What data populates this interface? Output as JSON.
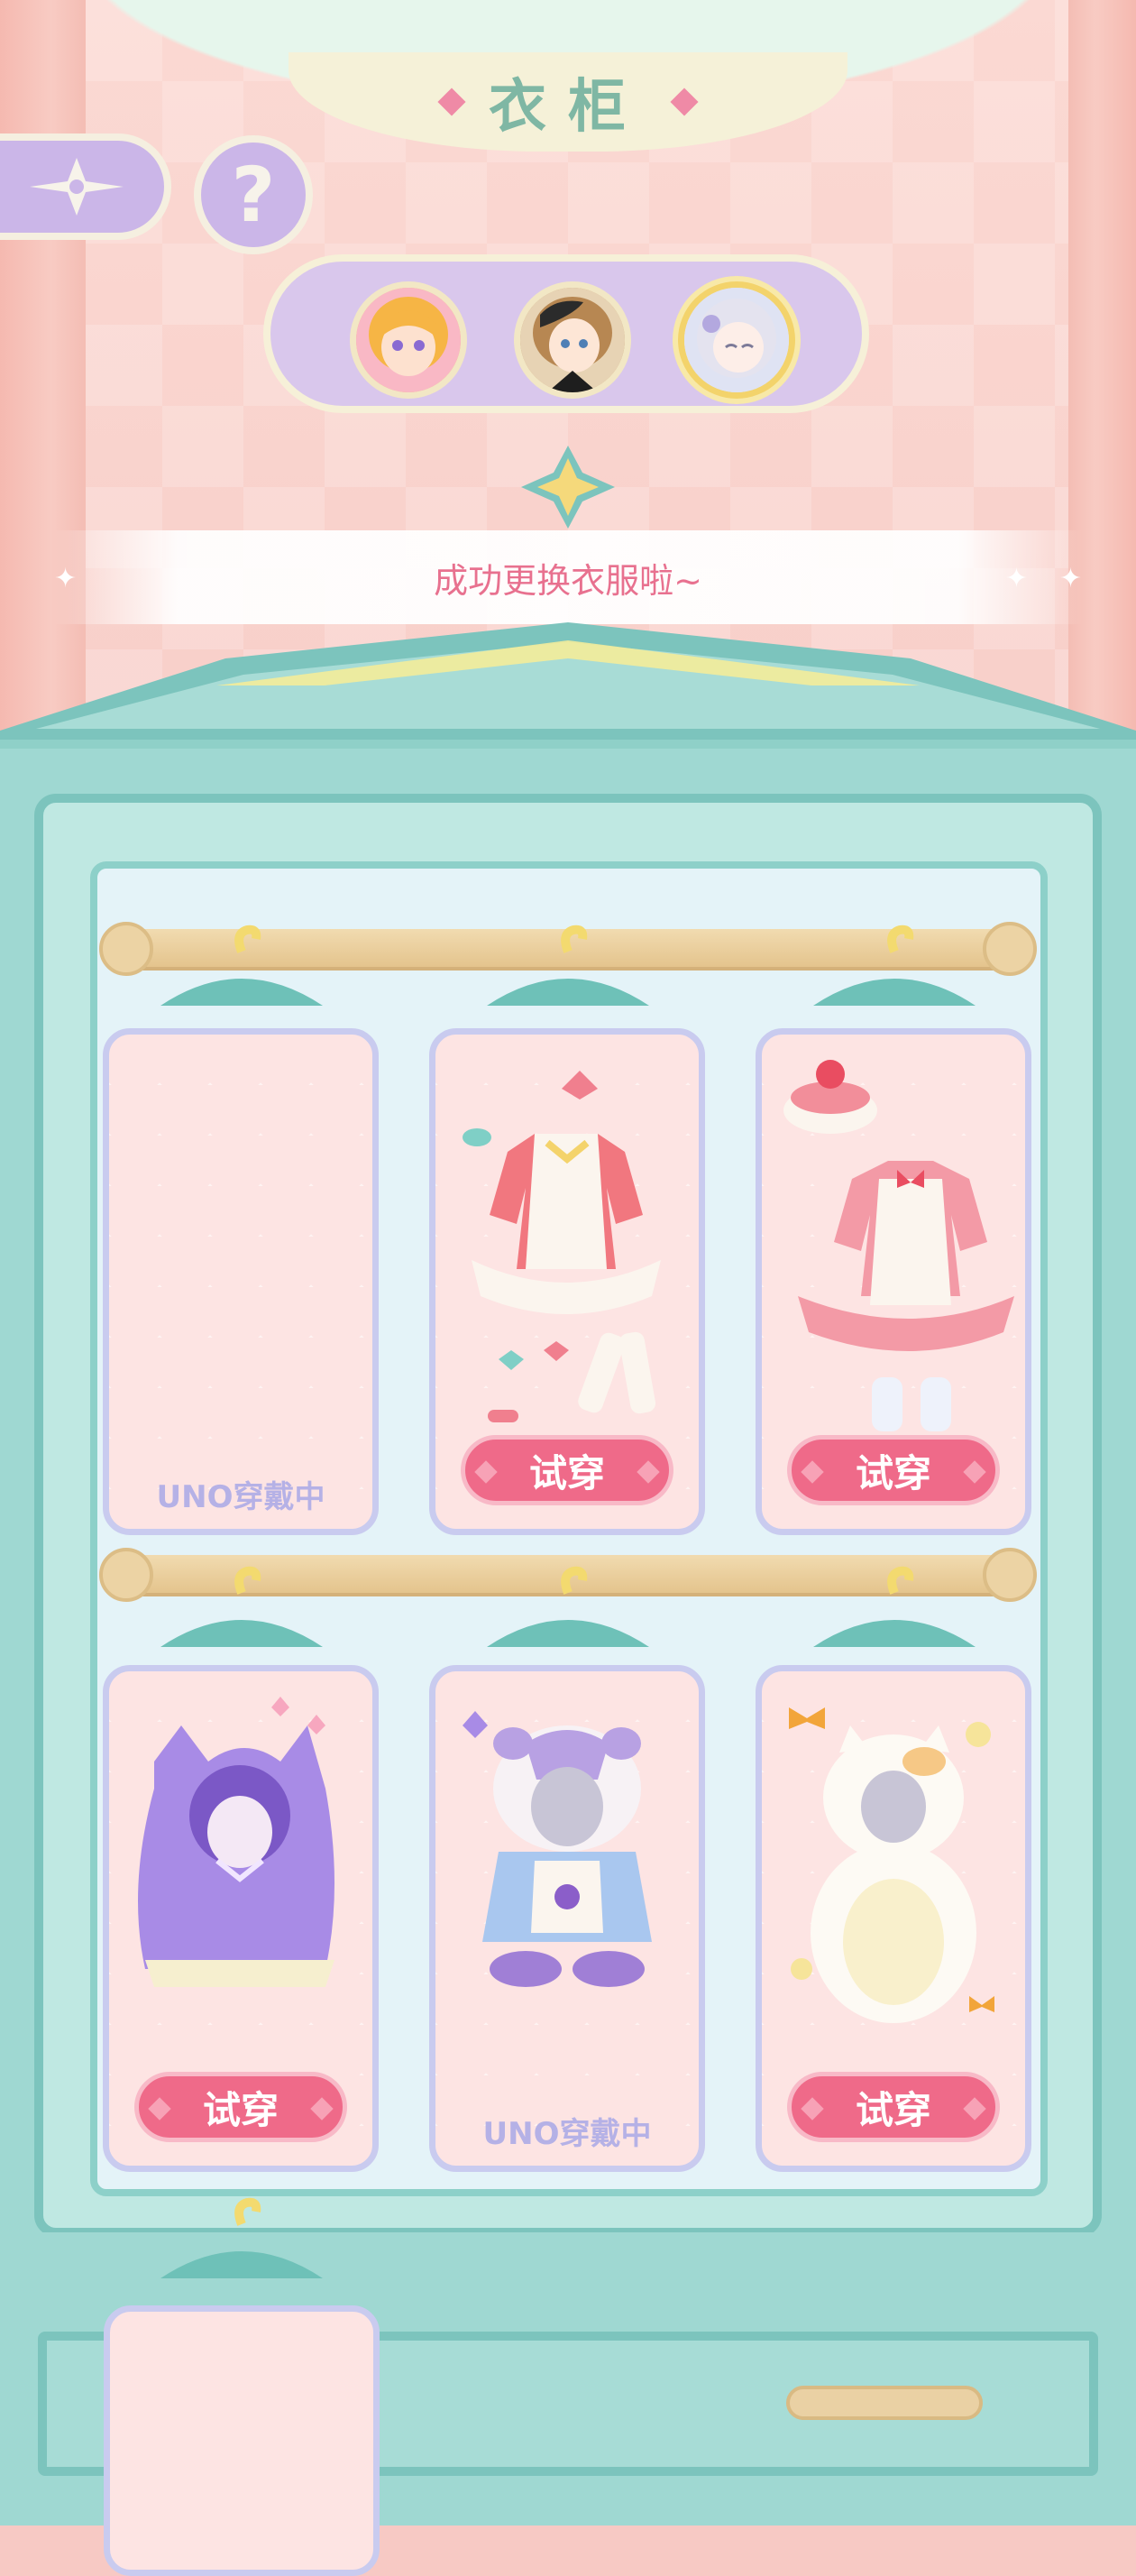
{
  "header": {
    "title": "衣柜"
  },
  "top_controls": {
    "back_icon": "four-point-star-icon",
    "help_label": "?"
  },
  "characters": [
    {
      "name": "blonde-girl",
      "selected": false,
      "bg": "#f6c06a"
    },
    {
      "name": "brown-hair-boy",
      "selected": false,
      "bg": "#c8a06f"
    },
    {
      "name": "silver-hair-girl",
      "selected": true,
      "bg": "#e9e6f3"
    }
  ],
  "notice": {
    "text": "成功更换衣服啦~"
  },
  "wardrobe": {
    "cards": [
      {
        "item": "empty",
        "state": "wearing",
        "label": "UNO穿戴中"
      },
      {
        "item": "pink-school-dress",
        "state": "try",
        "label": "试穿"
      },
      {
        "item": "strawberry-maid-dress",
        "state": "try",
        "label": "试穿"
      },
      {
        "item": "purple-cat-hoodie",
        "state": "try",
        "label": "试穿"
      },
      {
        "item": "hamster-costume",
        "state": "wearing",
        "label": "UNO穿戴中"
      },
      {
        "item": "white-cat-costume",
        "state": "try",
        "label": "试穿"
      }
    ]
  },
  "colors": {
    "accent_pink": "#ef6a89",
    "wardrobe_teal": "#9fd8d2",
    "lavender": "#cbb6e8"
  }
}
